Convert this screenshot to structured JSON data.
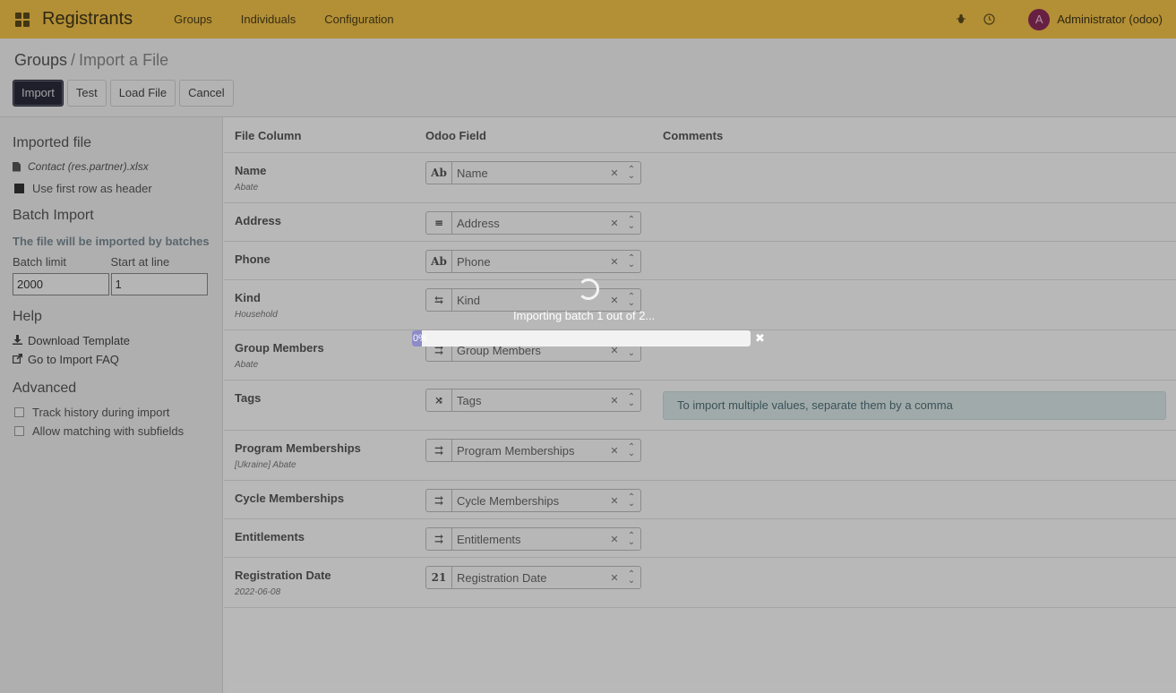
{
  "navbar": {
    "app_name": "Registrants",
    "menu": [
      "Groups",
      "Individuals",
      "Configuration"
    ],
    "user_initial": "A",
    "user_name": "Administrator (odoo)",
    "accent_color": "#f2c14a"
  },
  "breadcrumb": {
    "parent": "Groups",
    "separator": "/",
    "current": "Import a File"
  },
  "buttons": {
    "import": "Import",
    "test": "Test",
    "load_file": "Load File",
    "cancel": "Cancel"
  },
  "sidebar": {
    "imported_file_title": "Imported file",
    "file_name": "Contact (res.partner).xlsx",
    "use_first_row": "Use first row as header",
    "batch_title": "Batch Import",
    "batch_info": "The file will be imported by batches",
    "batch_limit_label": "Batch limit",
    "batch_limit_value": "2000",
    "start_line_label": "Start at line",
    "start_line_value": "1",
    "help_title": "Help",
    "download_template": "Download Template",
    "import_faq": "Go to Import FAQ",
    "advanced_title": "Advanced",
    "track_history": "Track history during import",
    "allow_matching": "Allow matching with subfields"
  },
  "table": {
    "headers": {
      "file_column": "File Column",
      "odoo_field": "Odoo Field",
      "comments": "Comments"
    },
    "rows": [
      {
        "name": "Name",
        "sample": "Abate",
        "type_icon": "Ab",
        "field": "Name",
        "comment": ""
      },
      {
        "name": "Address",
        "sample": "",
        "type_icon": "≡",
        "field": "Address",
        "comment": ""
      },
      {
        "name": "Phone",
        "sample": "",
        "type_icon": "Ab",
        "field": "Phone",
        "comment": ""
      },
      {
        "name": "Kind",
        "sample": "Household",
        "type_icon": "⇆",
        "field": "Kind",
        "comment": ""
      },
      {
        "name": "Group Members",
        "sample": "Abate",
        "type_icon": "⇉",
        "field": "Group Members",
        "comment": ""
      },
      {
        "name": "Tags",
        "sample": "",
        "type_icon": "⤨",
        "field": "Tags",
        "comment": "To import multiple values, separate them by a comma"
      },
      {
        "name": "Program Memberships",
        "sample": "[Ukraine] Abate",
        "type_icon": "⇉",
        "field": "Program Memberships",
        "comment": ""
      },
      {
        "name": "Cycle Memberships",
        "sample": "",
        "type_icon": "⇉",
        "field": "Cycle Memberships",
        "comment": ""
      },
      {
        "name": "Entitlements",
        "sample": "",
        "type_icon": "⇉",
        "field": "Entitlements",
        "comment": ""
      },
      {
        "name": "Registration Date",
        "sample": "2022-06-08",
        "type_icon": "21",
        "field": "Registration Date",
        "comment": ""
      }
    ]
  },
  "loading": {
    "message": "Importing batch 1 out of 2...",
    "progress_label": "0%",
    "progress_fraction": 0.0
  }
}
